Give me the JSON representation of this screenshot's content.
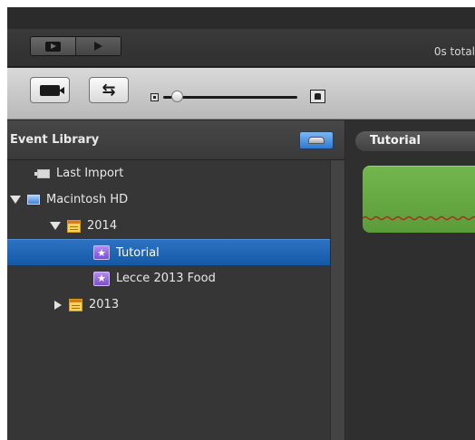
{
  "playback": {
    "total_time": "0s total"
  },
  "toolbar": {
    "buttons": [
      "camera-import",
      "swap-events-projects"
    ],
    "slider": {
      "label_icons": [
        "small-thumbnail-icon",
        "large-thumbnail-icon"
      ],
      "position_fraction": 0.06
    }
  },
  "event_library": {
    "title": "Event Library",
    "items": [
      {
        "label": "Last Import",
        "icon": "import-icon"
      },
      {
        "label": "Macintosh HD",
        "icon": "hard-drive-icon",
        "expanded": true
      },
      {
        "label": "2014",
        "icon": "calendar-icon",
        "expanded": true
      },
      {
        "label": "Tutorial",
        "icon": "star-event-icon",
        "selected": true
      },
      {
        "label": "Lecce 2013 Food",
        "icon": "star-event-icon"
      },
      {
        "label": "2013",
        "icon": "calendar-icon",
        "expanded": false
      }
    ]
  },
  "event_browser": {
    "title": "Tutorial"
  },
  "colors": {
    "selection": "#1f66b8",
    "clip": "#65a843",
    "wave": "#b32a1d"
  }
}
